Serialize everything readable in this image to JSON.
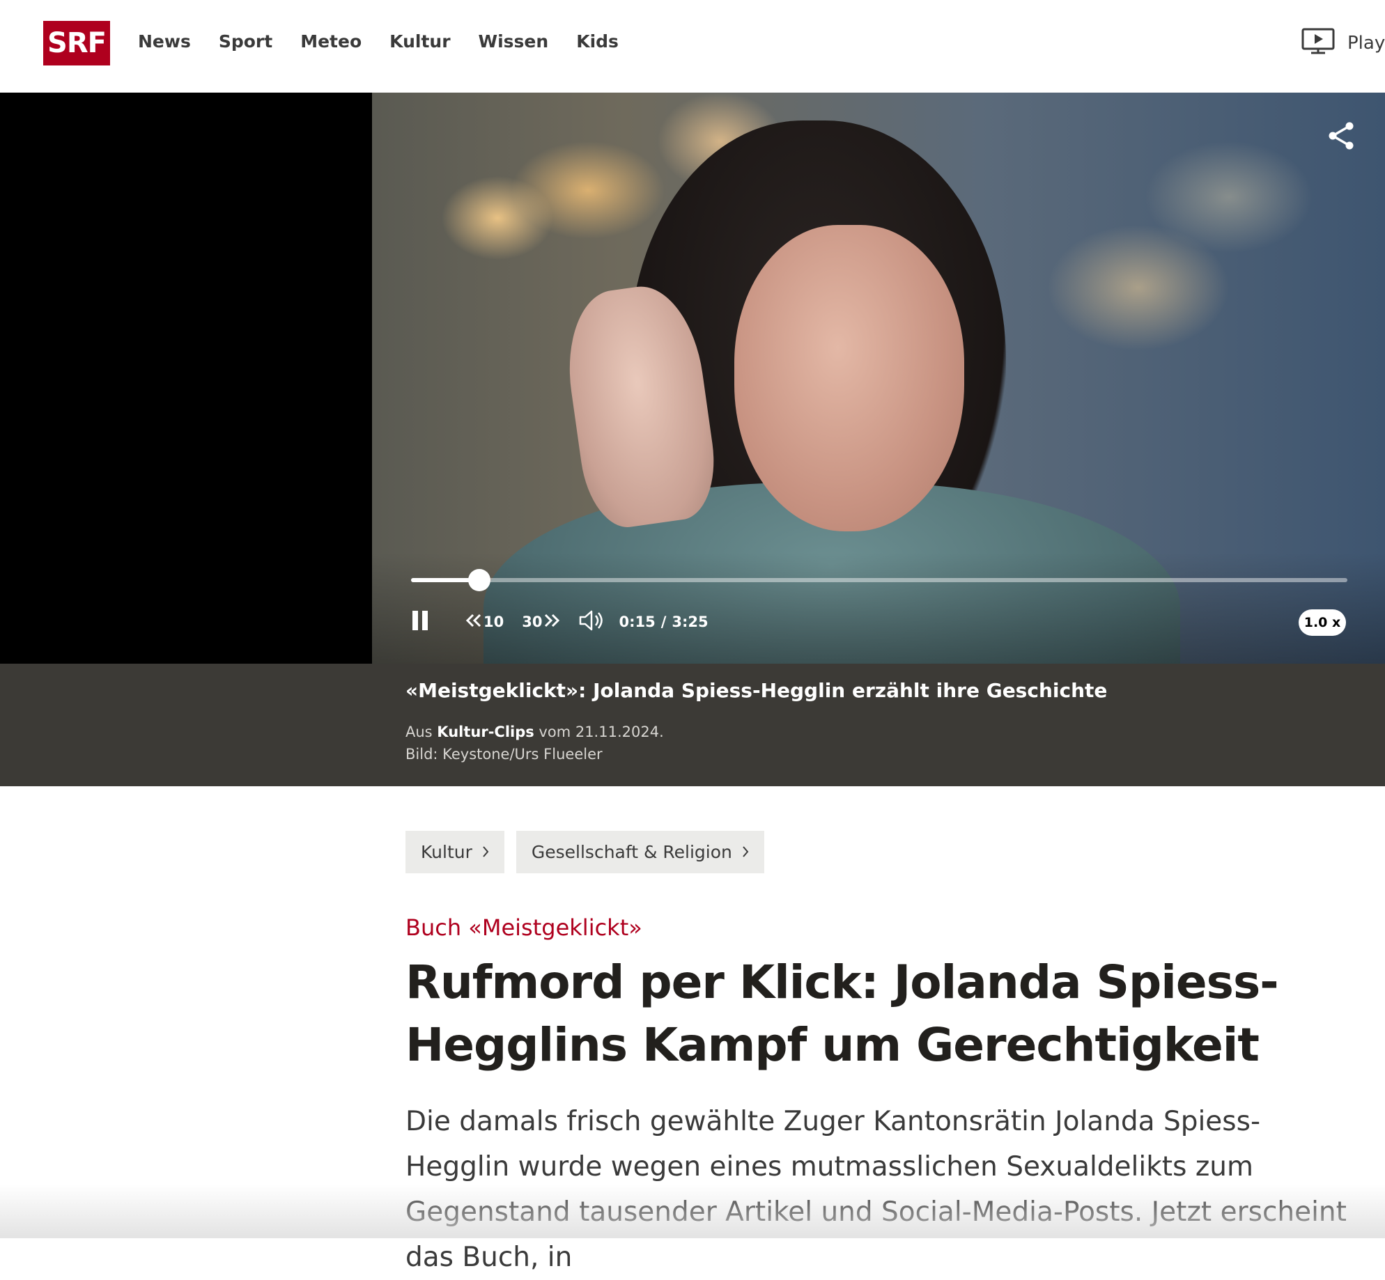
{
  "header": {
    "logo": "SRF",
    "nav": [
      "News",
      "Sport",
      "Meteo",
      "Kultur",
      "Wissen",
      "Kids"
    ],
    "play_label": "Play"
  },
  "player": {
    "current_time": "0:15",
    "separator": "/",
    "duration": "3:25",
    "progress_fraction": 0.073,
    "rewind_label": "10",
    "forward_label": "30",
    "speed_label": "1.0 x"
  },
  "caption": {
    "title": "«Meistgeklickt»: Jolanda Spiess-Hegglin erzählt ihre Geschichte",
    "source_prefix": "Aus ",
    "source_name": "Kultur-Clips",
    "source_suffix": " vom 21.11.2024.",
    "credit": "Bild: Keystone/Urs Flueeler"
  },
  "breadcrumbs": [
    "Kultur",
    "Gesellschaft & Religion"
  ],
  "article": {
    "kicker": "Buch «Meistgeklickt»",
    "headline": "Rufmord per Klick: Jolanda Spiess-Hegglins Kampf um Gerechtigkeit",
    "lead": "Die damals frisch gewählte Zuger Kantonsrätin Jolanda Spiess-Hegglin wurde wegen eines mutmasslichen Sexualdelikts zum Gegenstand tausender Artikel und Social-Media-Posts. Jetzt erscheint das Buch, in"
  },
  "colors": {
    "brand": "#af001e",
    "caption_bg": "#3c3a36",
    "chip_bg": "#ebebe9"
  }
}
